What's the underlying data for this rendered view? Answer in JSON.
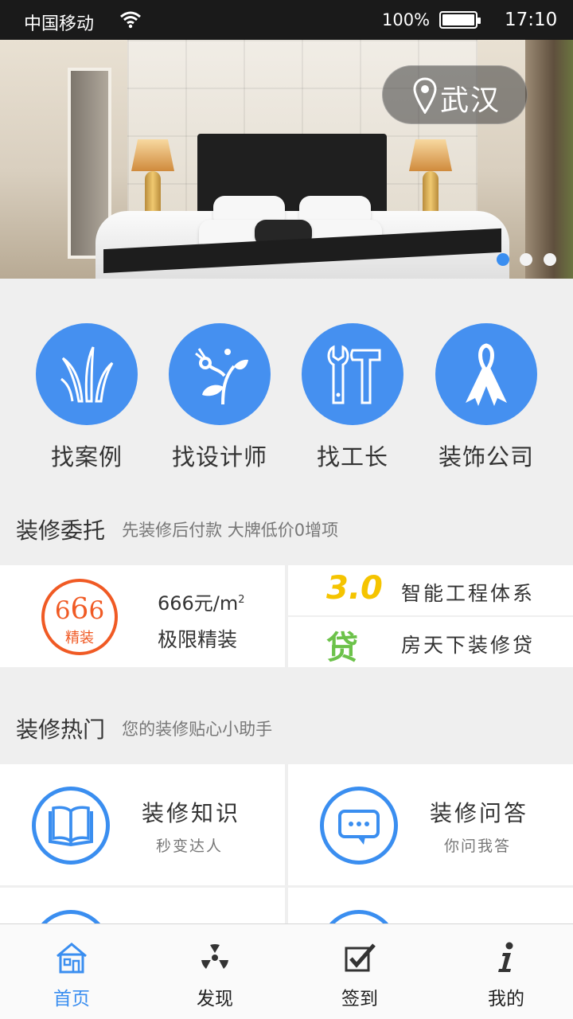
{
  "status_bar": {
    "carrier": "中国移动",
    "battery": "100%",
    "time": "17:10",
    "icons": [
      "wifi-icon",
      "battery-icon"
    ]
  },
  "banner": {
    "city": "武汉",
    "location_icon": "map-pin-icon",
    "slides": 3,
    "active_slide": 1
  },
  "categories": [
    {
      "label": "找案例",
      "icon": "grass-icon"
    },
    {
      "label": "找设计师",
      "icon": "plant-icon"
    },
    {
      "label": "找工长",
      "icon": "tools-icon"
    },
    {
      "label": "装饰公司",
      "icon": "ribbon-icon"
    }
  ],
  "commission": {
    "title": "装修委托",
    "subtitle": "先装修后付款  大牌低价0增项",
    "badge": {
      "d1": "6",
      "d2": "6",
      "d3": "6",
      "tag": "精装"
    },
    "price": "666元/m",
    "price_sup": "2",
    "package": "极限精装",
    "rows": [
      {
        "icon_text": "3.0",
        "label": "智能工程体系",
        "color": "#f5c400"
      },
      {
        "icon_text": "贷",
        "label": "房天下装修贷",
        "color": "#6cc24a"
      }
    ]
  },
  "hot": {
    "title": "装修热门",
    "subtitle": "您的装修贴心小助手",
    "tools": [
      {
        "name": "装修知识",
        "desc": "秒变达人",
        "icon": "book-icon"
      },
      {
        "name": "装修问答",
        "desc": "你问我答",
        "icon": "chat-bubble-icon"
      }
    ]
  },
  "tabbar": {
    "tabs": [
      {
        "label": "首页",
        "icon": "home-icon",
        "active": true
      },
      {
        "label": "发现",
        "icon": "radiation-icon",
        "active": false
      },
      {
        "label": "签到",
        "icon": "checkbox-icon",
        "active": false
      },
      {
        "label": "我的",
        "icon": "info-icon",
        "active": false
      }
    ]
  },
  "colors": {
    "accent": "#3a8ef0",
    "category_circle": "#4590f0",
    "badge_orange": "#f05a24"
  }
}
